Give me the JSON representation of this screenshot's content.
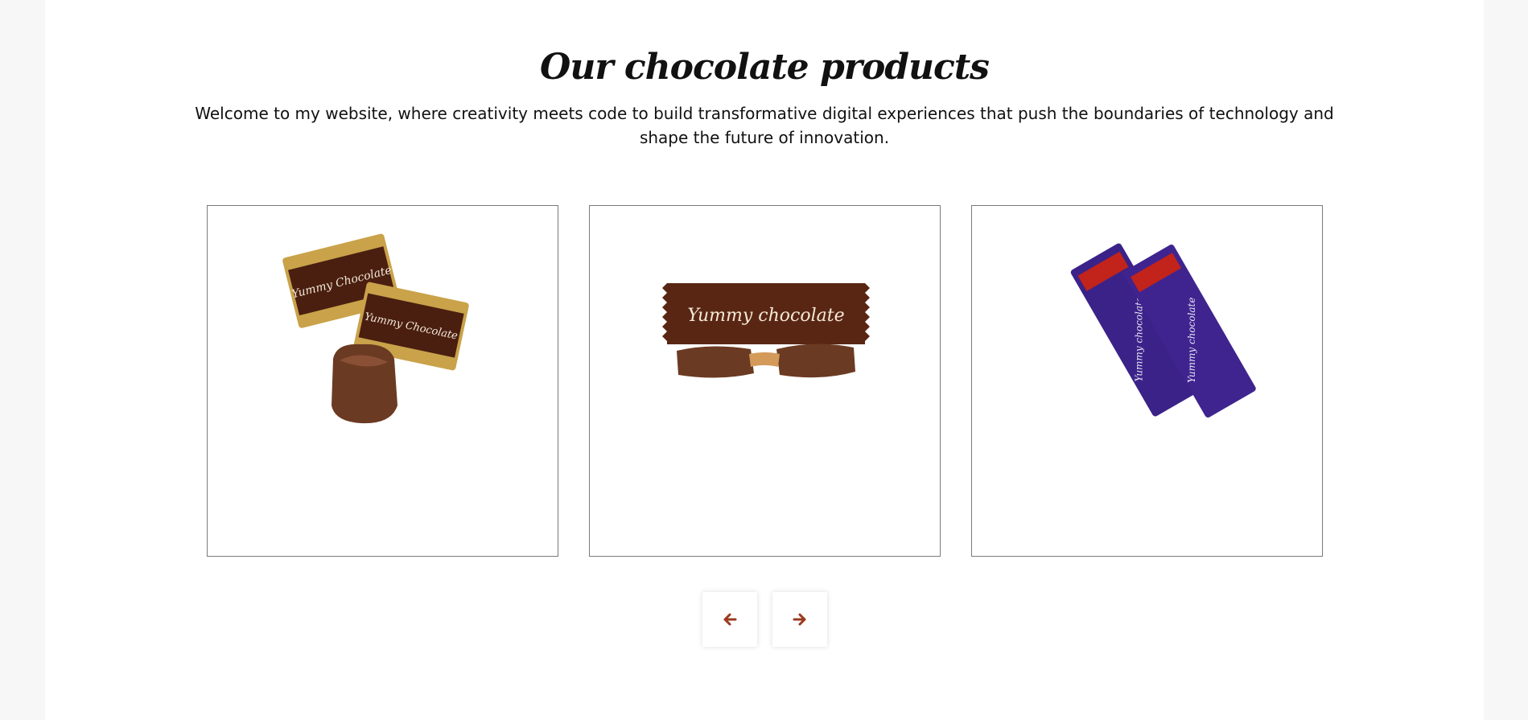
{
  "section": {
    "title": "Our chocolate products",
    "subtitle": "Welcome to my website, where creativity meets code to build transformative digital experiences that push the boundaries of technology and shape the future of innovation."
  },
  "products": [
    {
      "image": "chocolate-candies",
      "brand_text": "Yummy Chocolate"
    },
    {
      "image": "chocolate-bar",
      "brand_text": "Yummy chocolate"
    },
    {
      "image": "purple-chocolate-bars",
      "brand_text": "Yummy chocolate"
    }
  ],
  "carousel": {
    "prev_icon": "arrow-left-icon",
    "next_icon": "arrow-right-icon",
    "accent_color": "#9b3a1f"
  }
}
